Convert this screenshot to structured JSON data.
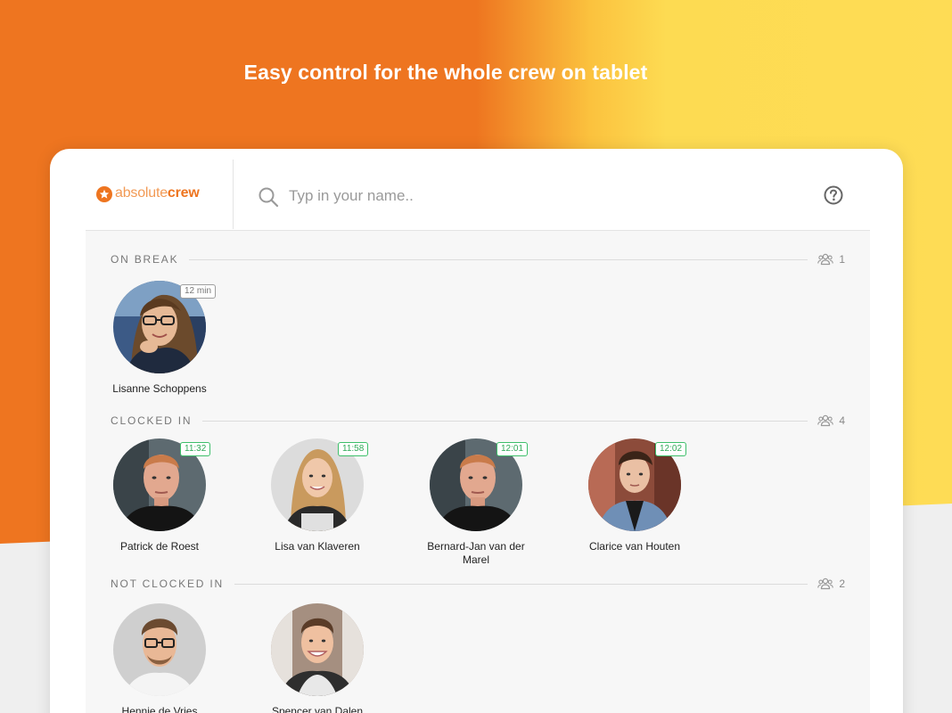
{
  "headline": "Easy control for the whole crew on tablet",
  "colors": {
    "brand_orange": "#ee7520",
    "brand_yellow": "#fedc55",
    "clocked_green": "#2faa58",
    "break_gray": "#9e9e9e"
  },
  "app": {
    "logo": {
      "part1": "absolute",
      "part2": "crew"
    },
    "search": {
      "placeholder": "Typ in your name..",
      "value": ""
    },
    "icons": {
      "search": "search-icon",
      "help": "help-circle-icon",
      "group": "group-icon"
    }
  },
  "sections": {
    "on_break": {
      "title": "ON BREAK",
      "count": "1",
      "people": [
        {
          "name": "Lisanne Schoppens",
          "badge": "12 min"
        }
      ]
    },
    "clocked_in": {
      "title": "CLOCKED IN",
      "count": "4",
      "people": [
        {
          "name": "Patrick de Roest",
          "badge": "11:32"
        },
        {
          "name": "Lisa van Klaveren",
          "badge": "11:58"
        },
        {
          "name": "Bernard-Jan van der Marel",
          "badge": "12:01"
        },
        {
          "name": "Clarice van Houten",
          "badge": "12:02"
        }
      ]
    },
    "not_clocked_in": {
      "title": "NOT CLOCKED IN",
      "count": "2",
      "people": [
        {
          "name": "Hennie de Vries"
        },
        {
          "name": "Spencer van Dalen"
        }
      ]
    }
  }
}
